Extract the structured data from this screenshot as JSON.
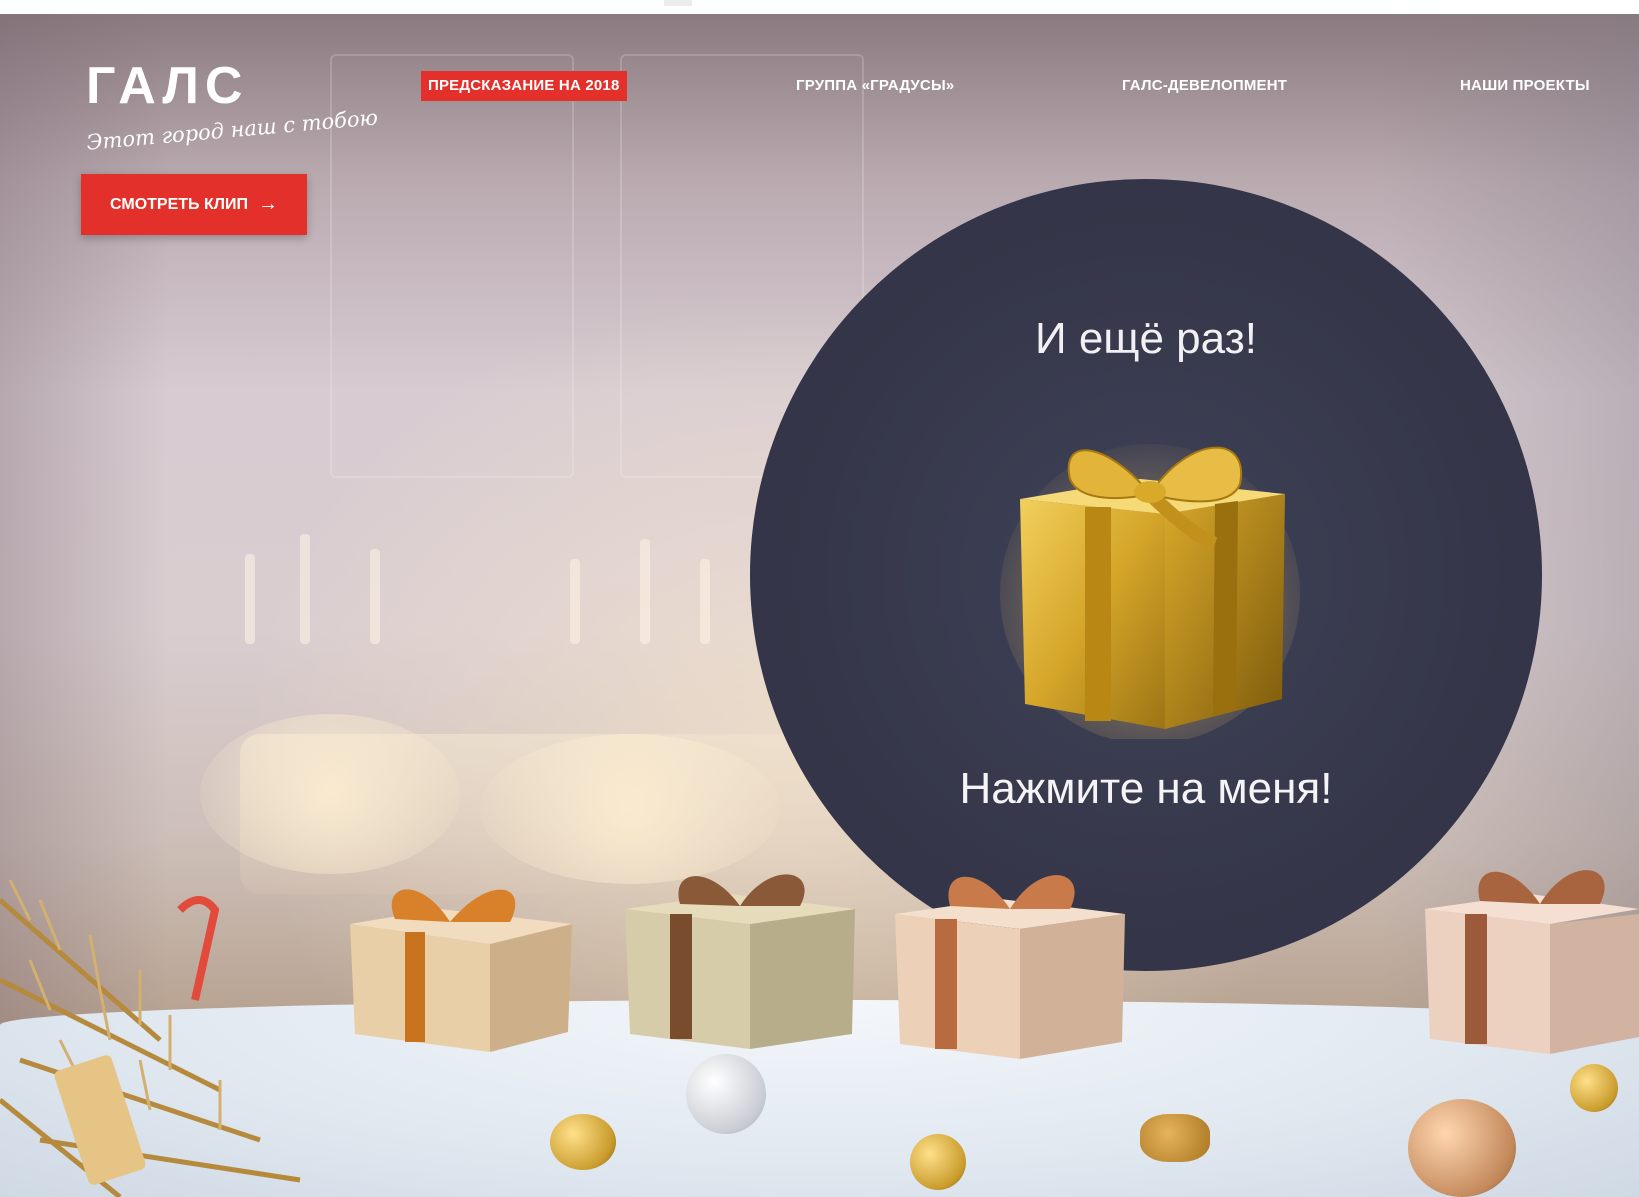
{
  "brand": {
    "logo_text": "ГАЛС",
    "tagline": "Этот город наш с тобою"
  },
  "nav": {
    "items": [
      {
        "label": "ПРЕДСКАЗАНИЕ НА 2018",
        "active": true
      },
      {
        "label": "ГРУППА «ГРАДУСЫ»",
        "active": false
      },
      {
        "label": "ГАЛС-ДЕВЕЛОПМЕНТ",
        "active": false
      },
      {
        "label": "НАШИ ПРОЕКТЫ",
        "active": false
      }
    ]
  },
  "clip_button": {
    "label": "СМОТРЕТЬ КЛИП",
    "icon": "arrow-right-icon"
  },
  "prediction": {
    "title": "И ещё раз!",
    "cta": "Нажмите на меня!",
    "gift_icon": "gift-box-icon"
  },
  "colors": {
    "accent": "#e4302a",
    "circle": "#353649",
    "gold": "#d9a92a"
  }
}
